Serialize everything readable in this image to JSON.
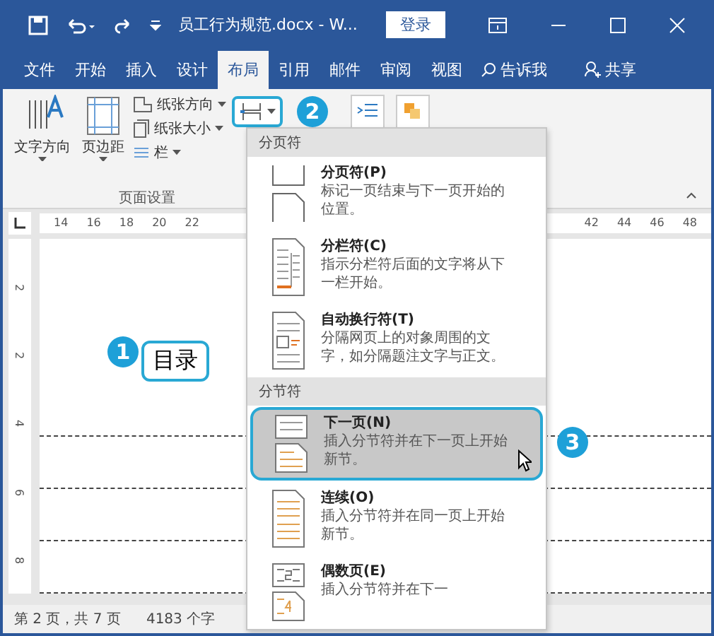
{
  "window": {
    "title": "员工行为规范.docx - W...",
    "login_button": "登录"
  },
  "tabs": [
    {
      "label": "文件",
      "selected": false
    },
    {
      "label": "开始",
      "selected": false
    },
    {
      "label": "插入",
      "selected": false
    },
    {
      "label": "设计",
      "selected": false
    },
    {
      "label": "布局",
      "selected": true
    },
    {
      "label": "引用",
      "selected": false
    },
    {
      "label": "邮件",
      "selected": false
    },
    {
      "label": "审阅",
      "selected": false
    },
    {
      "label": "视图",
      "selected": false
    }
  ],
  "tell_me": "告诉我",
  "share": "共享",
  "ribbon": {
    "text_direction": "文字方向",
    "margins": "页边距",
    "orientation": "纸张方向",
    "size": "纸张大小",
    "columns": "栏",
    "group_label": "页面设置"
  },
  "ruler": {
    "left_numbers": [
      "14",
      "16",
      "18",
      "20",
      "22"
    ],
    "right_numbers": [
      "42",
      "44",
      "46",
      "48"
    ],
    "vertical_numbers": [
      "2",
      "2",
      "4",
      "6",
      "8"
    ]
  },
  "document": {
    "heading": "目录"
  },
  "callouts": [
    "1",
    "2",
    "3"
  ],
  "dropdown": {
    "sections": [
      {
        "header": "分页符",
        "items": [
          {
            "kind": "page",
            "title": "分页符(P)",
            "desc": "标记一页结束与下一页开始的位置。",
            "selected": false
          },
          {
            "kind": "column",
            "title": "分栏符(C)",
            "desc": "指示分栏符后面的文字将从下一栏开始。",
            "selected": false
          },
          {
            "kind": "wrap",
            "title": "自动换行符(T)",
            "desc": "分隔网页上的对象周围的文字，如分隔题注文字与正文。",
            "selected": false
          }
        ]
      },
      {
        "header": "分节符",
        "items": [
          {
            "kind": "next",
            "title": "下一页(N)",
            "desc": "插入分节符并在下一页上开始新节。",
            "selected": true
          },
          {
            "kind": "continuous",
            "title": "连续(O)",
            "desc": "插入分节符并在同一页上开始新节。",
            "selected": false
          },
          {
            "kind": "even",
            "title": "偶数页(E)",
            "desc": "插入分节符并在下一",
            "selected": false
          }
        ]
      }
    ]
  },
  "status_bar": {
    "page": "第 2 页，共 7 页",
    "words": "4183 个字"
  }
}
